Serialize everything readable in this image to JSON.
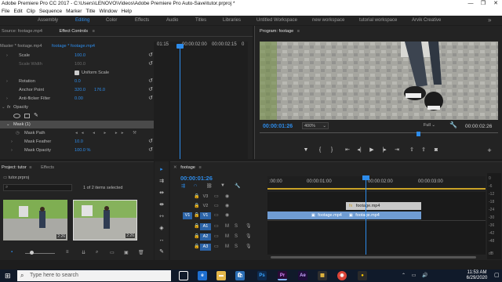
{
  "window": {
    "title": "Adobe Premiere Pro CC 2017 - C:\\Users\\LENOVO\\Videos\\Adobe Premiere Pro Auto-Save\\tutor.prproj *",
    "minimize": "—",
    "maximize": "❐",
    "close": "✕"
  },
  "menu": [
    "File",
    "Edit",
    "Clip",
    "Sequence",
    "Marker",
    "Title",
    "Window",
    "Help"
  ],
  "workspaces": {
    "items": [
      "Assembly",
      "Editing",
      "Color",
      "Effects",
      "Audio",
      "Titles",
      "Libraries",
      "Untitled Workspace",
      "new workspace",
      "tutorial workspace",
      "Arvik Creative"
    ],
    "active": "Editing",
    "overflow": "»"
  },
  "effect_controls": {
    "tab_source": "Source: footage.mp4",
    "tab_effects": "Effect Controls",
    "menu_icon": "≡",
    "clip_master": "Master * footage.mp4",
    "clip_seq": "footage * footage.mp4",
    "ruler_times": [
      "01:15",
      "00:00:02:00",
      "00:00:02:15",
      "0"
    ],
    "rows": [
      {
        "label": "Scale",
        "value": "100.0",
        "value2": "",
        "dim": false
      },
      {
        "label": "Scale Width",
        "value": "100.0",
        "value2": "",
        "dim": true
      },
      {
        "label": "Uniform Scale",
        "value": "",
        "value2": "",
        "dim": false
      },
      {
        "label": "Rotation",
        "value": "0.0",
        "value2": "",
        "dim": false
      },
      {
        "label": "Anchor Point",
        "value": "320.0",
        "value2": "176.0",
        "dim": false
      },
      {
        "label": "Anti-flicker Filter",
        "value": "0.00",
        "value2": "",
        "dim": false
      },
      {
        "label": "Opacity",
        "value": "",
        "value2": "",
        "dim": false
      },
      {
        "label": "Mask (1)",
        "value": "",
        "value2": "",
        "dim": false
      },
      {
        "label": "Mask Path",
        "value": "",
        "value2": "",
        "dim": false
      },
      {
        "label": "Mask Feather",
        "value": "10.0",
        "value2": "",
        "dim": false
      },
      {
        "label": "Mask Opacity",
        "value": "100.0 %",
        "value2": "",
        "dim": false
      }
    ],
    "timecode": "00:00:01:26"
  },
  "program": {
    "title": "Program: footage",
    "menu_icon": "≡",
    "timecode": "00:00:01:26",
    "zoom": "400%",
    "quality": "Full",
    "duration": "00:00:02:26"
  },
  "project": {
    "tab_project": "Project: tutor",
    "tab_effects": "Effects",
    "menu_icon": "≡",
    "file": "tutor.prproj",
    "items_selected": "1 of 2 items selected",
    "thumbs": [
      {
        "name": "footage.mp4",
        "duration": "2:26"
      },
      {
        "name": "footage",
        "duration": "2:26"
      }
    ]
  },
  "timeline": {
    "tab": "footage",
    "menu_icon": "≡",
    "timecode": "00:00:01:26",
    "ruler": [
      ":00:00",
      "00:00:01:00",
      "00:00:02:00",
      "00:00:03:00"
    ],
    "tracks": [
      {
        "id": "V3",
        "kind": "video"
      },
      {
        "id": "V2",
        "kind": "video"
      },
      {
        "id": "V1",
        "kind": "video"
      },
      {
        "id": "A1",
        "kind": "audio"
      },
      {
        "id": "A2",
        "kind": "audio"
      },
      {
        "id": "A3",
        "kind": "audio"
      }
    ],
    "clips": {
      "v2_clip": "footage.mp4",
      "v1_clip_a": "footage.mp4",
      "v1_clip_b": "footage.mp4"
    },
    "meter_labels": [
      "0",
      "-6",
      "-12",
      "-18",
      "-24",
      "-30",
      "-36",
      "-42",
      "-48",
      "dB"
    ]
  },
  "taskbar": {
    "search_placeholder": "Type here to search",
    "apps": [
      "Ps",
      "Pr",
      "Ae"
    ],
    "time": "11:53 AM",
    "date": "6/29/2020"
  },
  "colors": {
    "accent": "#2d8ceb",
    "clip_video": "#6f9cd3",
    "clip_adjust": "#c8c8c8",
    "taskbar": "#101a2a"
  }
}
